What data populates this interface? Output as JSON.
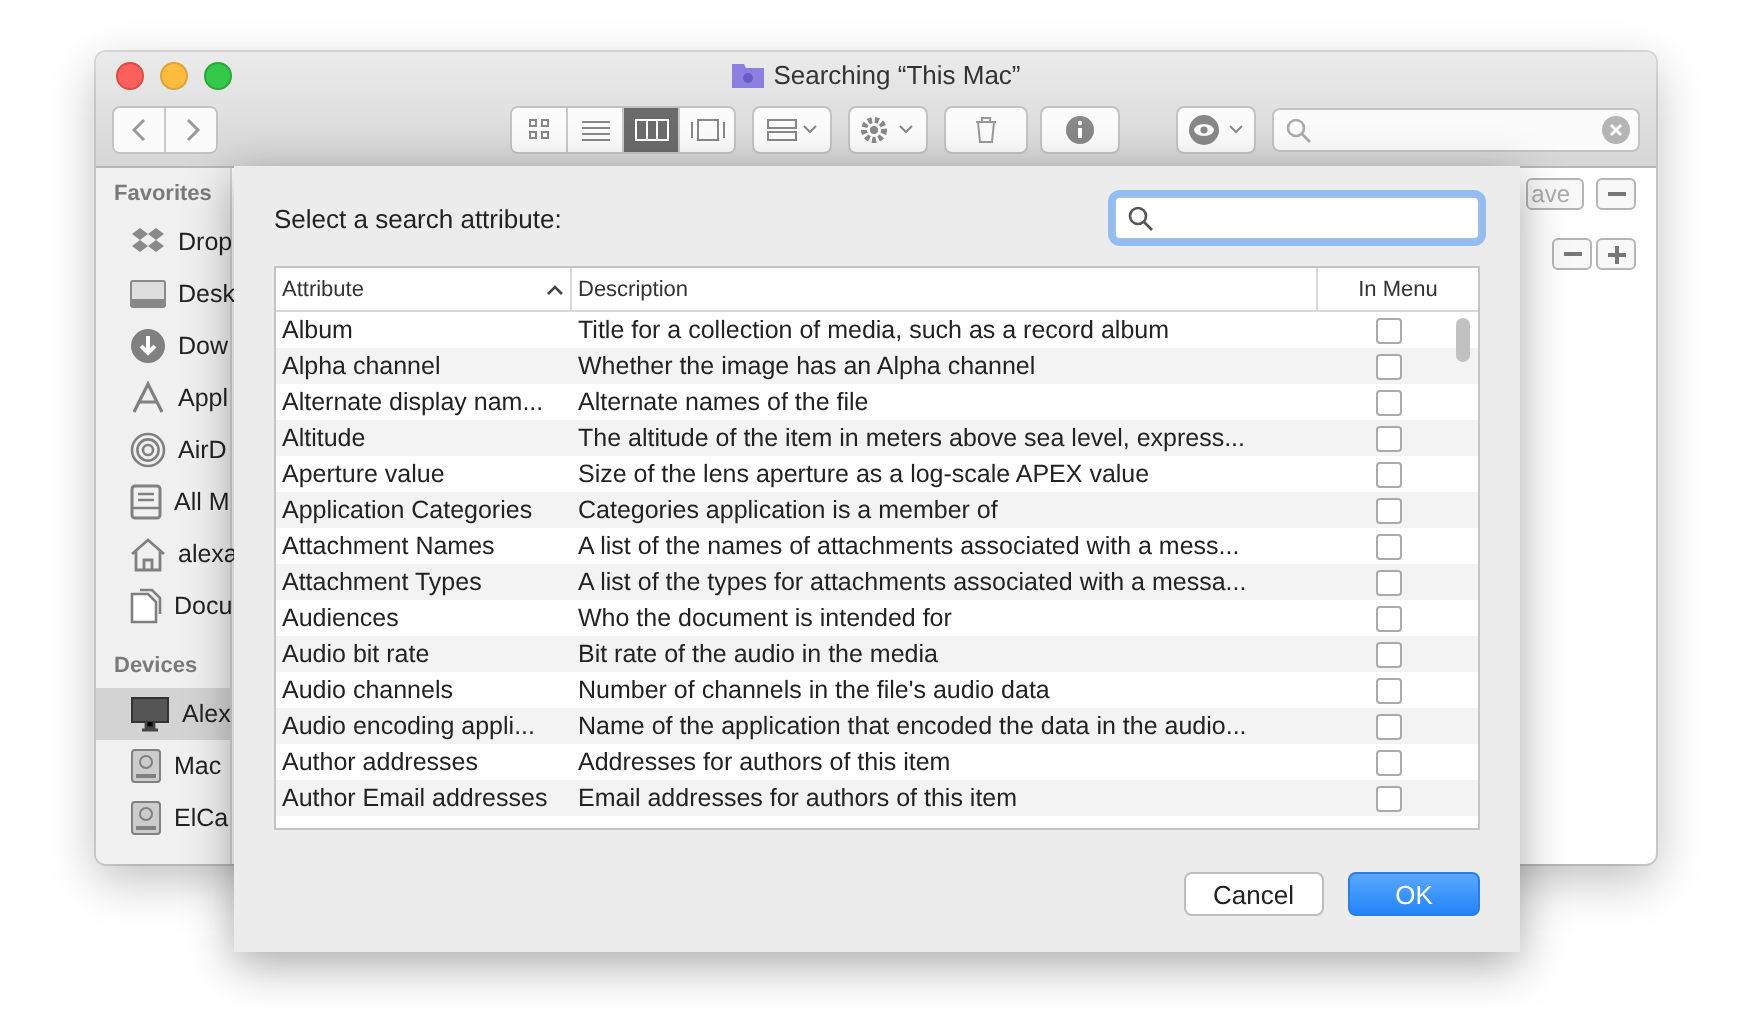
{
  "window": {
    "title": "Searching “This Mac”"
  },
  "toolbar": {
    "views": [
      {
        "kind": "icons",
        "selected": false
      },
      {
        "kind": "list",
        "selected": false
      },
      {
        "kind": "columns",
        "selected": true
      },
      {
        "kind": "gallery",
        "selected": false
      }
    ]
  },
  "sidebar": {
    "sections": [
      {
        "heading": "Favorites",
        "items": [
          {
            "label": "Drop",
            "kind": "dropbox",
            "selected": false
          },
          {
            "label": "Desk",
            "kind": "desktop",
            "selected": false
          },
          {
            "label": "Dow",
            "kind": "download",
            "selected": false
          },
          {
            "label": "Appl",
            "kind": "apps",
            "selected": false
          },
          {
            "label": "AirD",
            "kind": "airdrop",
            "selected": false
          },
          {
            "label": "All M",
            "kind": "tray",
            "selected": false
          },
          {
            "label": "alexa",
            "kind": "home",
            "selected": false
          },
          {
            "label": "Docu",
            "kind": "doc",
            "selected": false
          }
        ]
      },
      {
        "heading": "Devices",
        "items": [
          {
            "label": "Alex",
            "kind": "monitor",
            "selected": true
          },
          {
            "label": "Mac",
            "kind": "disk",
            "selected": false
          },
          {
            "label": "ElCa",
            "kind": "disk",
            "selected": false
          }
        ]
      }
    ]
  },
  "search_bar": {
    "save_button": "ave"
  },
  "dialog": {
    "prompt": "Select a search attribute:",
    "columns": [
      "Attribute",
      "Description",
      "In Menu"
    ],
    "rows": [
      {
        "attribute": "Album",
        "description": "Title for a collection of media, such as a record album",
        "in_menu": false
      },
      {
        "attribute": "Alpha channel",
        "description": "Whether the image has an Alpha channel",
        "in_menu": false
      },
      {
        "attribute": "Alternate display nam...",
        "description": "Alternate names of the file",
        "in_menu": false
      },
      {
        "attribute": "Altitude",
        "description": "The altitude of the item in meters above sea level, express...",
        "in_menu": false
      },
      {
        "attribute": "Aperture value",
        "description": "Size of the lens aperture as a log-scale APEX value",
        "in_menu": false
      },
      {
        "attribute": "Application Categories",
        "description": "Categories application is a member of",
        "in_menu": false
      },
      {
        "attribute": "Attachment Names",
        "description": "A list of the names of attachments associated with a mess...",
        "in_menu": false
      },
      {
        "attribute": "Attachment Types",
        "description": "A list of the types for attachments associated with a messa...",
        "in_menu": false
      },
      {
        "attribute": "Audiences",
        "description": "Who the document is intended for",
        "in_menu": false
      },
      {
        "attribute": "Audio bit rate",
        "description": "Bit rate of the audio in the media",
        "in_menu": false
      },
      {
        "attribute": "Audio channels",
        "description": "Number of channels in the file's audio data",
        "in_menu": false
      },
      {
        "attribute": "Audio encoding appli...",
        "description": "Name of the application that encoded the data in the audio...",
        "in_menu": false
      },
      {
        "attribute": "Author addresses",
        "description": "Addresses for authors of this item",
        "in_menu": false
      },
      {
        "attribute": "Author Email addresses",
        "description": "Email addresses for authors of this item",
        "in_menu": false
      }
    ],
    "buttons": [
      {
        "label": "Cancel",
        "kind": "normal"
      },
      {
        "label": "OK",
        "kind": "default"
      }
    ]
  }
}
